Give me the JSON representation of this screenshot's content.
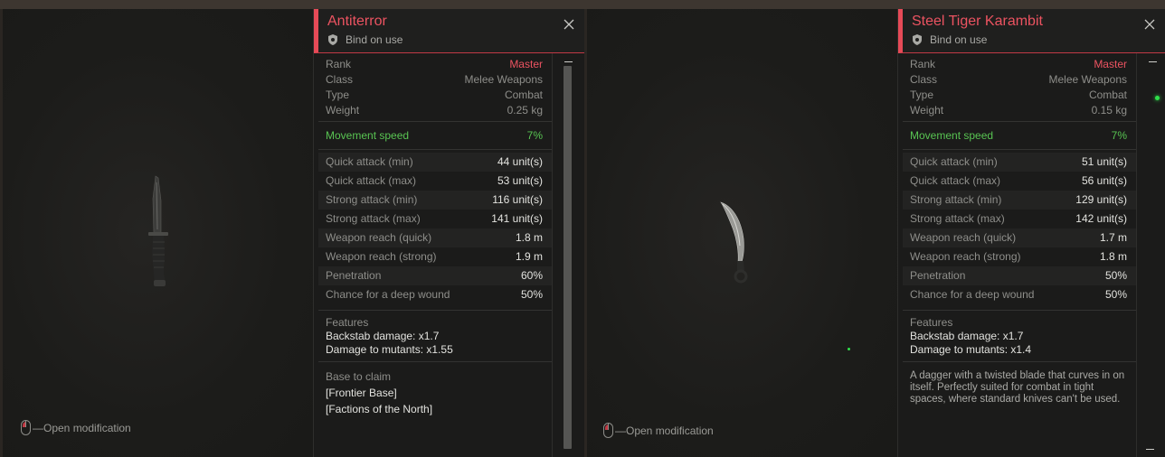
{
  "left": {
    "hint": "—Open modification",
    "card": {
      "title": "Antiterror",
      "bind": "Bind on use",
      "basic": [
        {
          "label": "Rank",
          "value": "Master"
        },
        {
          "label": "Class",
          "value": "Melee Weapons"
        },
        {
          "label": "Type",
          "value": "Combat"
        },
        {
          "label": "Weight",
          "value": "0.25 kg"
        }
      ],
      "movement": {
        "label": "Movement speed",
        "value": "7%"
      },
      "stats": [
        {
          "label": "Quick attack (min)",
          "value": "44 unit(s)"
        },
        {
          "label": "Quick attack (max)",
          "value": "53 unit(s)"
        },
        {
          "label": "Strong attack (min)",
          "value": "116 unit(s)"
        },
        {
          "label": "Strong attack (max)",
          "value": "141 unit(s)"
        },
        {
          "label": "Weapon reach (quick)",
          "value": "1.8 m"
        },
        {
          "label": "Weapon reach (strong)",
          "value": "1.9 m"
        },
        {
          "label": "Penetration",
          "value": "60%"
        },
        {
          "label": "Chance for a deep wound",
          "value": "50%"
        }
      ],
      "features": {
        "heading": "Features",
        "lines": [
          "Backstab damage: x1.7",
          "Damage to mutants: x1.55"
        ]
      },
      "base": {
        "heading": "Base to claim",
        "lines": [
          "[Frontier Base]",
          "[Factions of the North]"
        ]
      }
    }
  },
  "right": {
    "hint": "—Open modification",
    "card": {
      "title": "Steel Tiger Karambit",
      "bind": "Bind on use",
      "basic": [
        {
          "label": "Rank",
          "value": "Master"
        },
        {
          "label": "Class",
          "value": "Melee Weapons"
        },
        {
          "label": "Type",
          "value": "Combat"
        },
        {
          "label": "Weight",
          "value": "0.15 kg"
        }
      ],
      "movement": {
        "label": "Movement speed",
        "value": "7%"
      },
      "stats": [
        {
          "label": "Quick attack (min)",
          "value": "51 unit(s)"
        },
        {
          "label": "Quick attack (max)",
          "value": "56 unit(s)"
        },
        {
          "label": "Strong attack (min)",
          "value": "129 unit(s)"
        },
        {
          "label": "Strong attack (max)",
          "value": "142 unit(s)"
        },
        {
          "label": "Weapon reach (quick)",
          "value": "1.7 m"
        },
        {
          "label": "Weapon reach (strong)",
          "value": "1.8 m"
        },
        {
          "label": "Penetration",
          "value": "50%"
        },
        {
          "label": "Chance for a deep wound",
          "value": "50%"
        }
      ],
      "features": {
        "heading": "Features",
        "lines": [
          "Backstab damage: x1.7",
          "Damage to mutants: x1.4"
        ]
      },
      "description": "A dagger with a twisted blade that curves in on itself. Perfectly suited for combat in tight spaces, where standard knives can't be used."
    }
  },
  "colors": {
    "accent": "#e64a57",
    "rank": "#ec5361",
    "movement": "#58c452"
  }
}
